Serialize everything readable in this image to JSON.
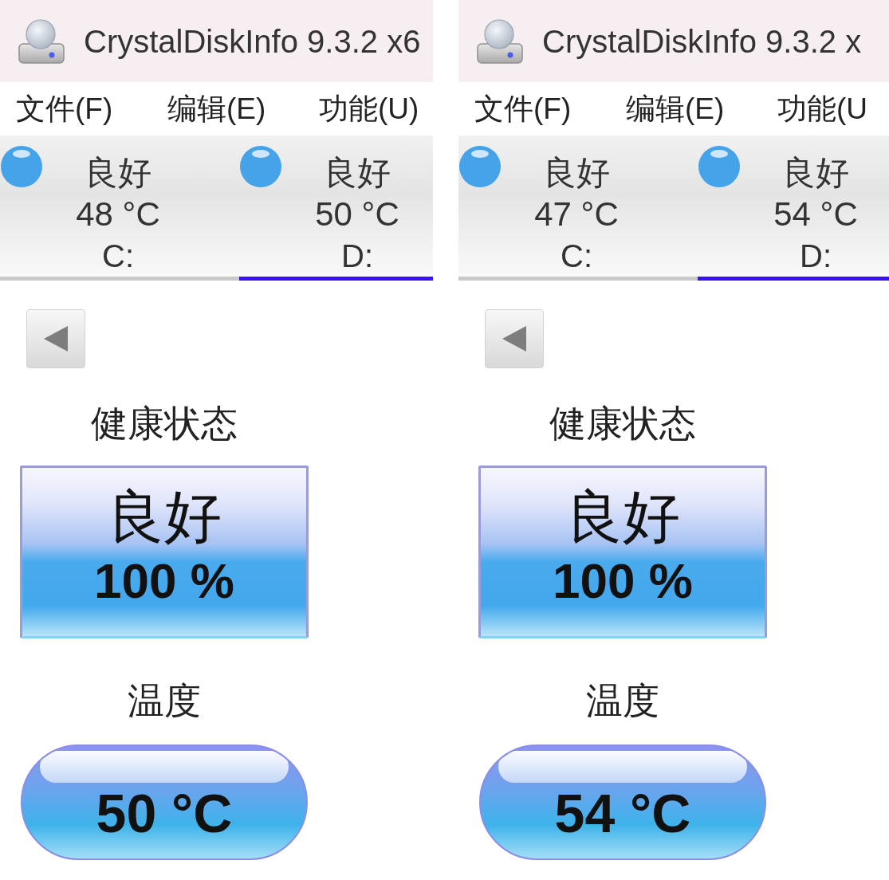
{
  "panels": [
    {
      "window": {
        "title": "CrystalDiskInfo 9.3.2 x6"
      },
      "menu": [
        {
          "label": "文件(F)"
        },
        {
          "label": "编辑(E)"
        },
        {
          "label": "功能(U)"
        }
      ],
      "disks": [
        {
          "status": "良好",
          "temperature": "48 °C",
          "drive": "C:",
          "selected": false,
          "color": "#45a3ea"
        },
        {
          "status": "良好",
          "temperature": "50 °C",
          "drive": "D:",
          "selected": true,
          "color": "#45a3ea"
        }
      ],
      "health": {
        "label": "健康状态",
        "status": "良好",
        "percent": "100 %"
      },
      "temperature": {
        "label": "温度",
        "reading": "50 °C"
      }
    },
    {
      "window": {
        "title": "CrystalDiskInfo 9.3.2 x"
      },
      "menu": [
        {
          "label": "文件(F)"
        },
        {
          "label": "编辑(E)"
        },
        {
          "label": "功能(U"
        }
      ],
      "disks": [
        {
          "status": "良好",
          "temperature": "47 °C",
          "drive": "C:",
          "selected": false,
          "color": "#45a3ea"
        },
        {
          "status": "良好",
          "temperature": "54 °C",
          "drive": "D:",
          "selected": true,
          "color": "#45a3ea"
        }
      ],
      "health": {
        "label": "健康状态",
        "status": "良好",
        "percent": "100 %"
      },
      "temperature": {
        "label": "温度",
        "reading": "54 °C"
      }
    }
  ]
}
